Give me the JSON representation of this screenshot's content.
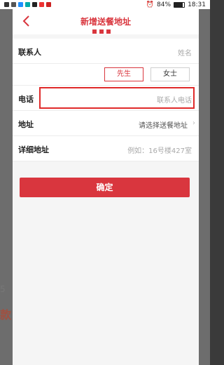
{
  "status_bar": {
    "battery": "84%",
    "time": "18:31"
  },
  "background": {
    "text1": "5",
    "text2": "款"
  },
  "header": {
    "title": "新增送餐地址"
  },
  "form": {
    "contact": {
      "label": "联系人",
      "placeholder": "姓名"
    },
    "gender": {
      "male": "先生",
      "female": "女士",
      "selected": "先生"
    },
    "phone": {
      "label": "电话",
      "placeholder": "联系人电话"
    },
    "address": {
      "label": "地址",
      "value": "请选择送餐地址"
    },
    "detail": {
      "label": "详细地址",
      "placeholder": "例如：16号楼427室"
    }
  },
  "confirm_label": "确定",
  "colors": {
    "accent": "#d9363e",
    "highlight": "#e02a2a"
  }
}
